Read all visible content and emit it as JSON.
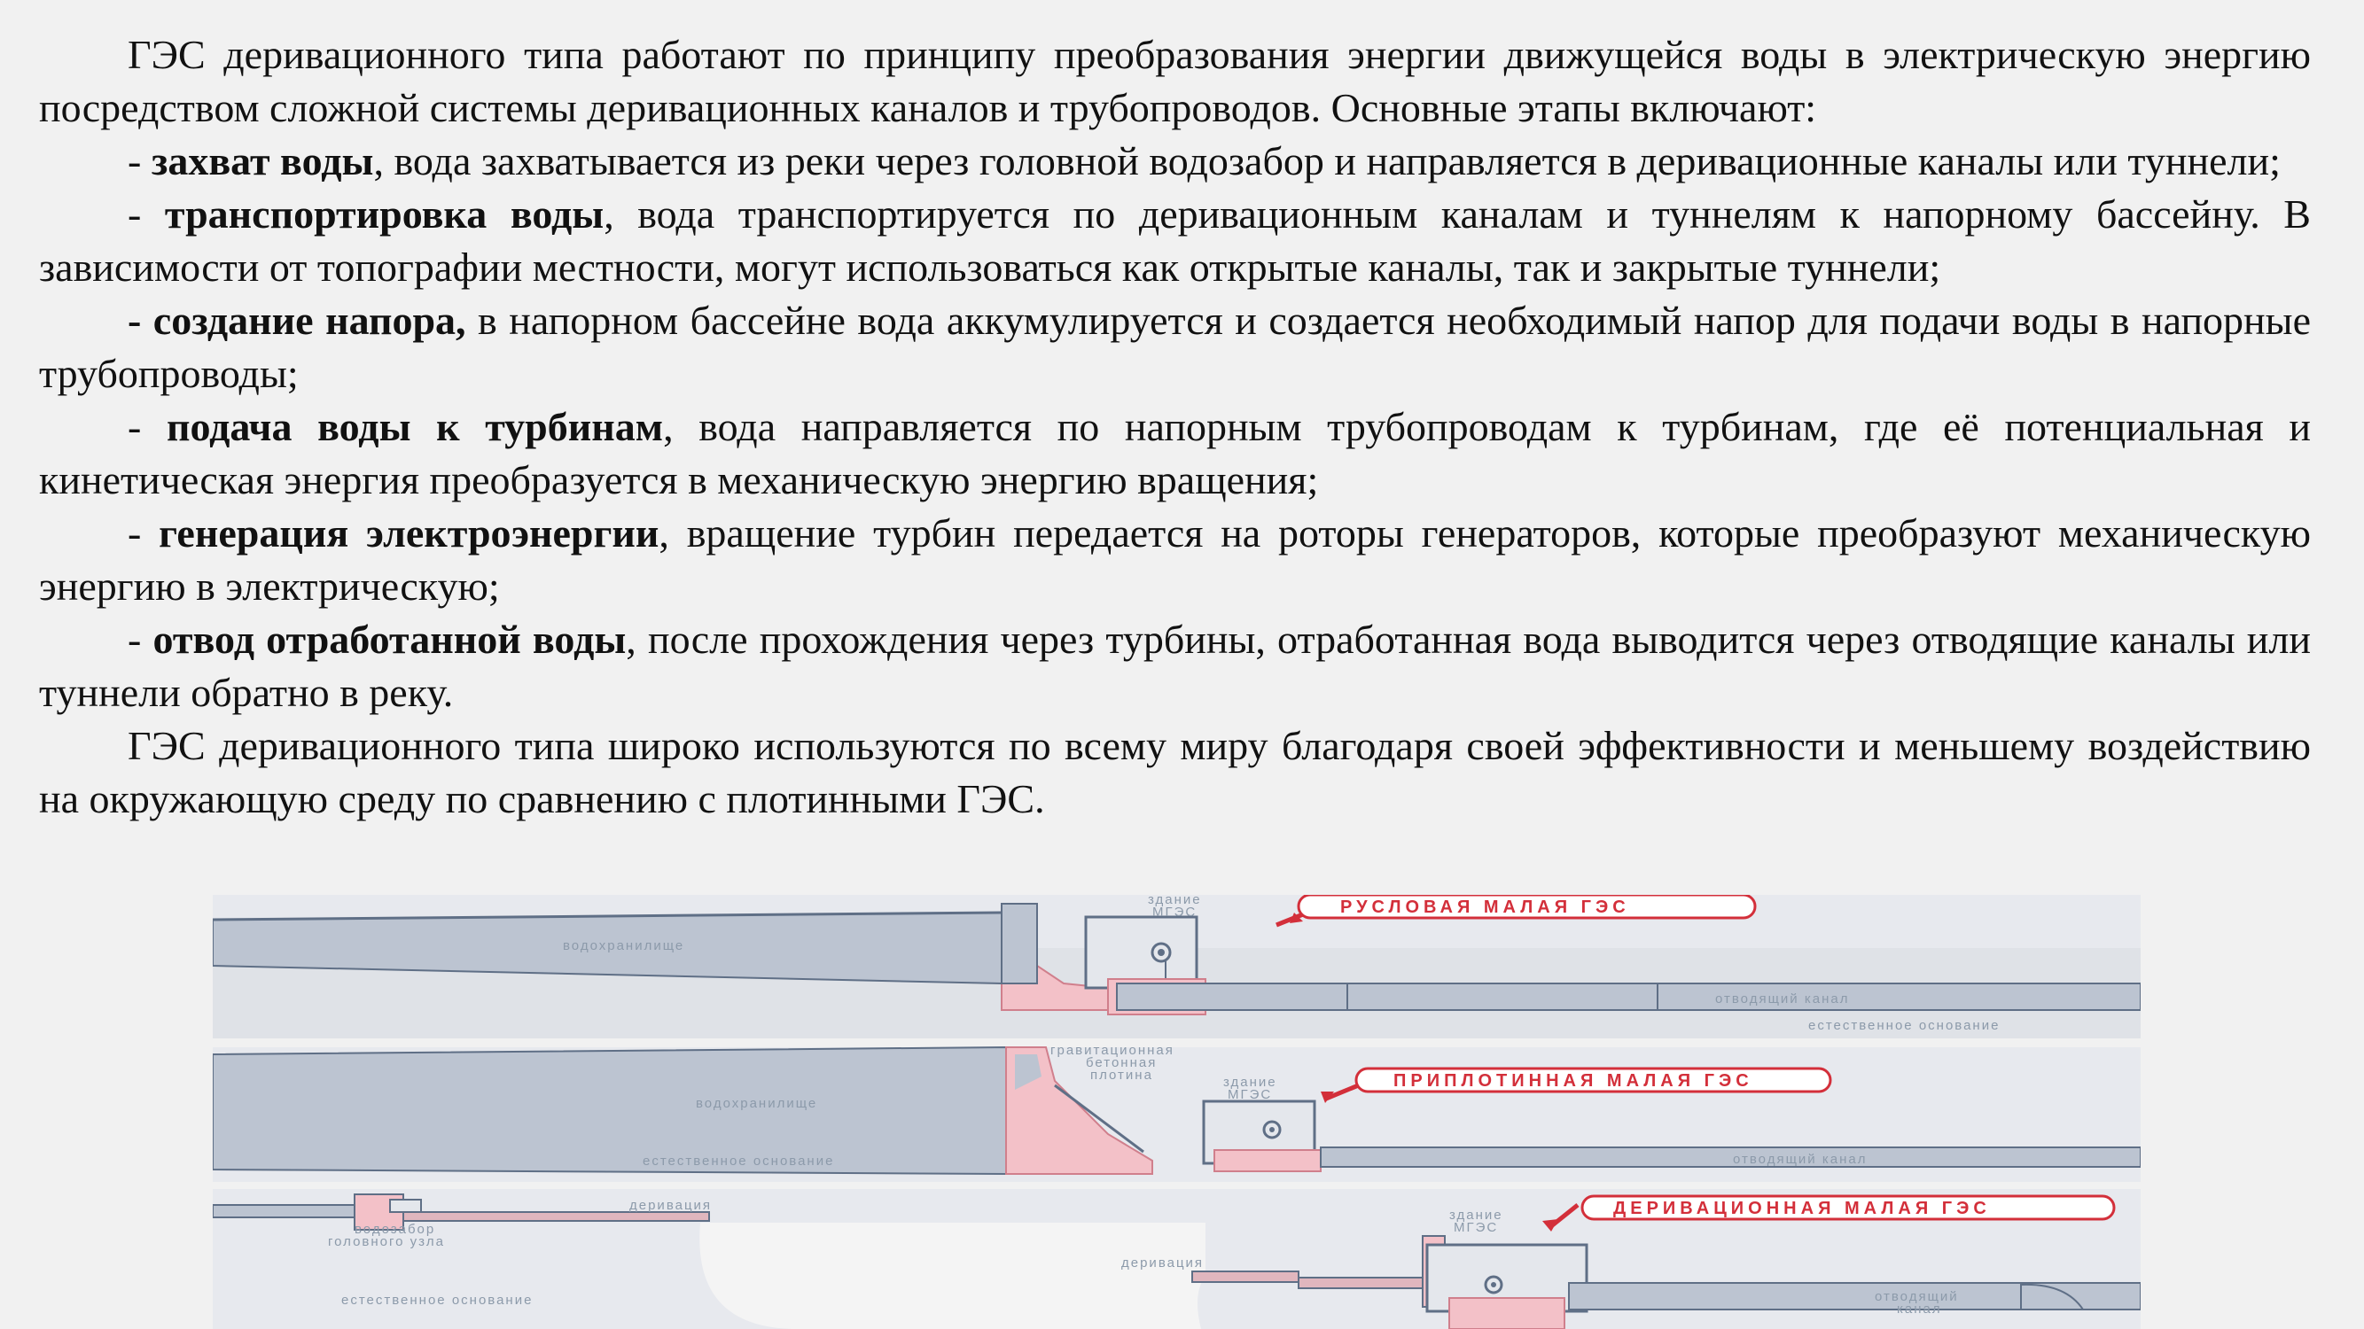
{
  "paragraphs": {
    "intro": "ГЭС деривационного типа работают по принципу преобразования энергии движущейся воды в электрическую энергию посредством сложной системы деривационных каналов и трубопроводов. Основные этапы включают:",
    "conclusion": "ГЭС деривационного типа широко используются по всему миру благодаря своей эффективности и меньшему воздействию на окружающую среду по сравнению с плотинными ГЭС."
  },
  "steps": [
    {
      "dash": "- ",
      "term": "захват воды",
      "text": ", вода захватывается из реки через головной водозабор и направляется в деривационные каналы или туннели;"
    },
    {
      "dash": "- ",
      "term": "транспортировка воды",
      "text": ", вода транспортируется по деривационным каналам и туннелям к напорному бассейну. В зависимости от топографии местности, могут использоваться как открытые каналы, так и закрытые туннели;"
    },
    {
      "dash": "",
      "term": "- создание напора,",
      "text": " в напорном бассейне вода аккумулируется и создается необходимый напор для подачи воды в напорные трубопроводы;"
    },
    {
      "dash": "- ",
      "term": "подача воды к турбинам",
      "text": ", вода направляется по напорным трубопроводам к турбинам, где её потенциальная и кинетическая энергия преобразуется в механическую энергию вращения;"
    },
    {
      "dash": "- ",
      "term": "генерация электроэнергии",
      "text": ", вращение турбин передается на роторы генераторов, которые преобразуют механическую энергию в электрическую;"
    },
    {
      "dash": "- ",
      "term": "отвод отработанной воды",
      "text": ", после прохождения через турбины, отработанная вода выводится через отводящие каналы или туннели обратно в реку."
    }
  ],
  "figure": {
    "panel1": {
      "title": "РУСЛОВАЯ МАЛАЯ ГЭС",
      "building_line1": "здание",
      "building_line2": "МГЭС",
      "reservoir": "водохранилище",
      "outlet": "отводящий канал",
      "ground": "естественное основание"
    },
    "panel2": {
      "title": "ПРИПЛОТИННАЯ МАЛАЯ ГЭС",
      "dam_line1": "гравитационная",
      "dam_line2": "бетонная",
      "dam_line3": "плотина",
      "building_line1": "здание",
      "building_line2": "МГЭС",
      "reservoir": "водохранилище",
      "ground": "естественное основание",
      "outlet": "отводящий канал"
    },
    "panel3": {
      "title": "ДЕРИВАЦИОННАЯ МАЛАЯ ГЭС",
      "derivation1": "деривация",
      "intake_line1": "водозабор",
      "intake_line2": "головного узла",
      "derivation2": "деривация",
      "building_line1": "здание",
      "building_line2": "МГЭС",
      "ground": "естественное основание",
      "outlet_line1": "отводящий",
      "outlet_line2": "канал"
    },
    "colors": {
      "water": "#bcc4d1",
      "structure": "#f3c1c8",
      "outline": "#5f6f86",
      "accent": "#d32f3a"
    }
  }
}
